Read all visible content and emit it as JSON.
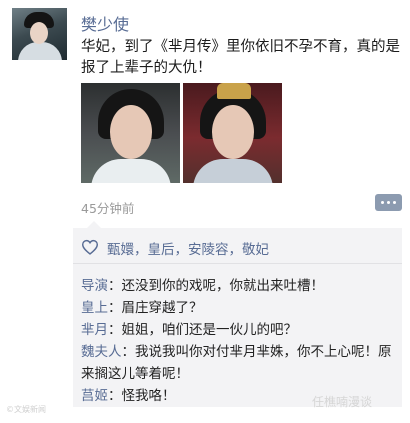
{
  "post": {
    "username": "樊少使",
    "text": "华妃，到了《芈月传》里你依旧不孕不育，真的是报了上辈子的大仇！",
    "timestamp": "45分钟前"
  },
  "likes": {
    "names": "甄嬛，皇后，安陵容，敬妃"
  },
  "comments": [
    {
      "author": "导演",
      "sep": "：",
      "text": "还没到你的戏呢，你就出来吐槽！"
    },
    {
      "author": "皇上",
      "sep": "：",
      "text": "眉庄穿越了？"
    },
    {
      "author": "芈月",
      "sep": "：",
      "text": "姐姐，咱们还是一伙儿的吧？"
    },
    {
      "author": "魏夫人",
      "sep": "：",
      "text": "我说我叫你对付芈月芈姝，你不上心呢！原来搁这儿等着呢！"
    },
    {
      "author": "莒姬",
      "sep": "：",
      "text": "怪我咯！"
    }
  ],
  "watermarks": {
    "left": "©文娱新闻",
    "right": "任樵喃漫谈"
  },
  "icons": {
    "heart": "heart-outline-icon",
    "comment": "comment-more-icon"
  },
  "colors": {
    "name_blue": "#586c94",
    "comment_bg": "#f3f3f5",
    "timestamp_gray": "#9a9a9a"
  }
}
